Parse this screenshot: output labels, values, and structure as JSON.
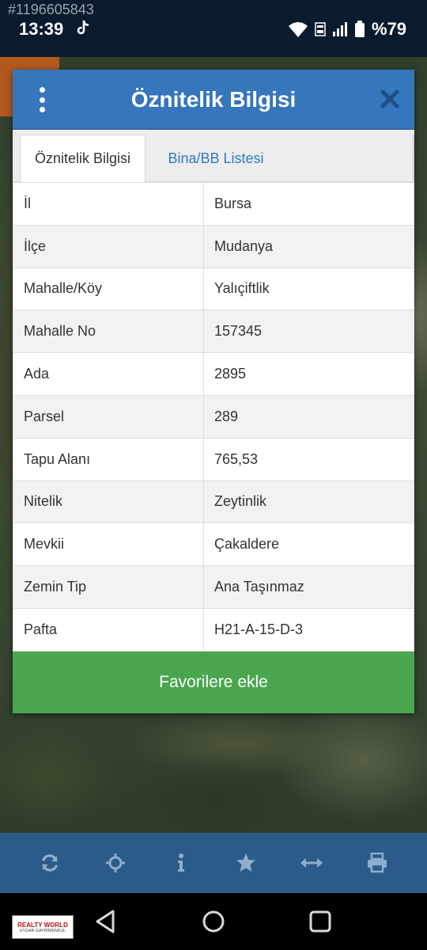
{
  "status_bar": {
    "watermark": "#1196605843",
    "time": "13:39",
    "battery": "%79"
  },
  "dialog": {
    "title": "Öznitelik Bilgisi",
    "tabs": [
      {
        "label": "Öznitelik Bilgisi",
        "active": true
      },
      {
        "label": "Bina/BB Listesi",
        "active": false
      }
    ],
    "rows": [
      {
        "key": "İl",
        "value": "Bursa"
      },
      {
        "key": "İlçe",
        "value": "Mudanya"
      },
      {
        "key": "Mahalle/Köy",
        "value": "Yalıçiftlik"
      },
      {
        "key": "Mahalle No",
        "value": "157345"
      },
      {
        "key": "Ada",
        "value": "2895"
      },
      {
        "key": "Parsel",
        "value": "289"
      },
      {
        "key": "Tapu Alanı",
        "value": "765,53"
      },
      {
        "key": "Nitelik",
        "value": "Zeytinlik"
      },
      {
        "key": "Mevkii",
        "value": "Çakaldere"
      },
      {
        "key": "Zemin Tip",
        "value": "Ana Taşınmaz"
      },
      {
        "key": "Pafta",
        "value": "H21-A-15-D-3"
      }
    ],
    "favorite_button": "Favorilere ekle"
  },
  "toolbar": {
    "tools": [
      "refresh-icon",
      "locate-icon",
      "info-icon",
      "star-icon",
      "measure-icon",
      "print-icon"
    ]
  },
  "logo": {
    "line1": "REALTY WORLD",
    "line2": "UYGAR GAYRİMENKUL"
  },
  "colors": {
    "header_blue": "#3576bd",
    "tab_link_blue": "#2f78bf",
    "favorite_green": "#49a64f",
    "toolbar_blue": "#2b5b88"
  }
}
